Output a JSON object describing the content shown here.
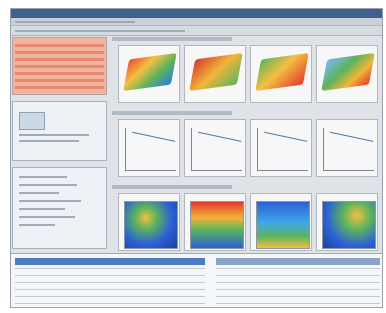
{
  "window": {
    "title": "",
    "colors": {
      "titlebar": "#3f5f8f",
      "accent": "#4b7cc4",
      "heatmap_hot": "#e3392d",
      "heatmap_cold": "#2c61d6",
      "surface_green": "#5db35c"
    }
  },
  "left_panel": {
    "sections": [
      {
        "name": "spreadsheet-list",
        "highlighted": true
      },
      {
        "name": "preview-panel"
      },
      {
        "name": "properties-panel"
      }
    ]
  },
  "main": {
    "rows": [
      {
        "type": "surface-plot",
        "count": 4
      },
      {
        "type": "line-plot",
        "count": 4
      },
      {
        "type": "heatmap",
        "count": 4
      }
    ]
  },
  "bottom": {
    "tables": [
      {
        "name": "data-table-left"
      },
      {
        "name": "data-table-right"
      }
    ]
  }
}
